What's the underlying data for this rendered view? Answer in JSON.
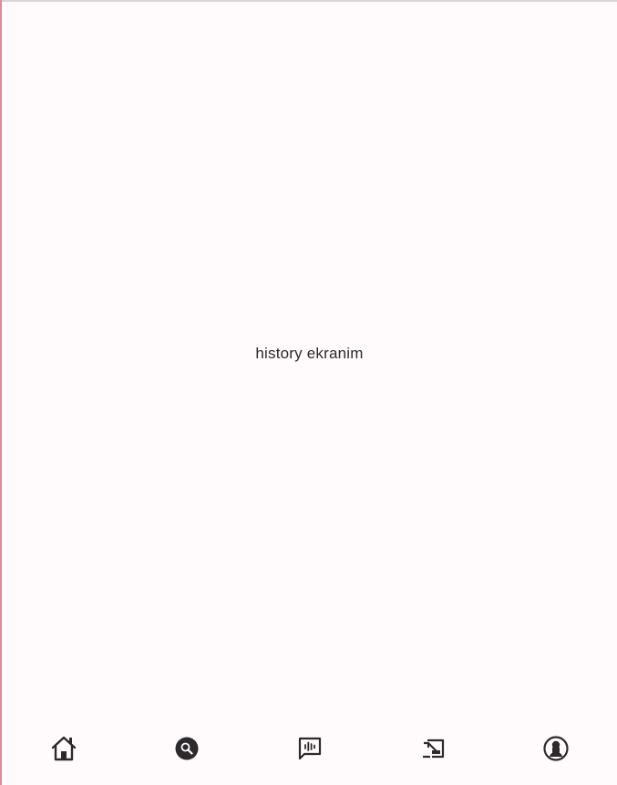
{
  "main": {
    "text": "history ekranim"
  },
  "bottom_nav": {
    "items": [
      {
        "icon": "home-icon",
        "name": "nav-home"
      },
      {
        "icon": "search-icon",
        "name": "nav-search"
      },
      {
        "icon": "voice-chat-icon",
        "name": "nav-voice-chat"
      },
      {
        "icon": "history-icon",
        "name": "nav-history"
      },
      {
        "icon": "account-icon",
        "name": "nav-profile"
      }
    ]
  },
  "colors": {
    "background": "#fffafb",
    "icon": "#2d2a2e",
    "left_border": "#e08a96"
  }
}
